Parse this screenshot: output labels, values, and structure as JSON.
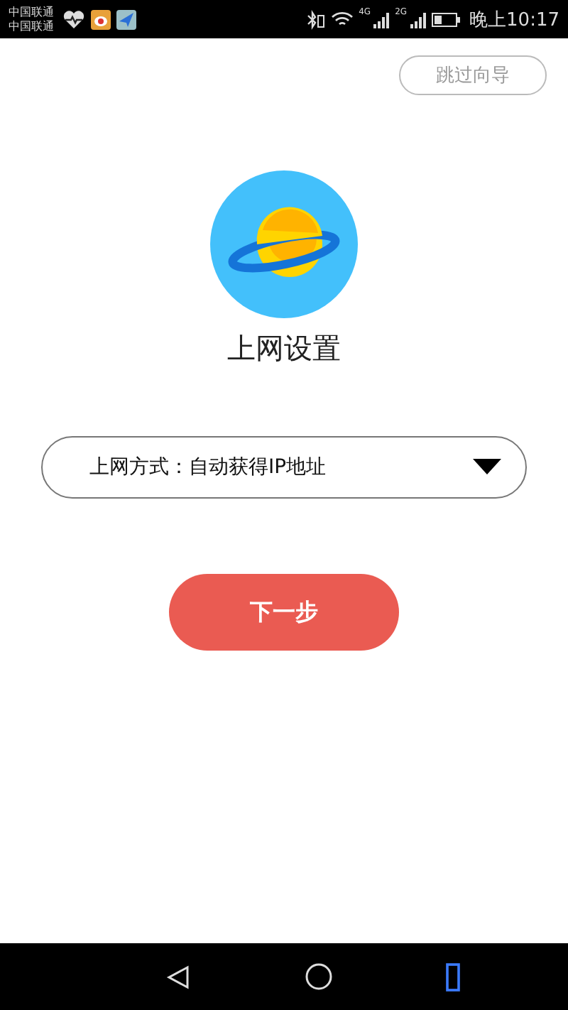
{
  "status_bar": {
    "carriers": [
      "中国联通",
      "中国联通"
    ],
    "network_1": "4G",
    "network_2": "2G",
    "time": "晚上10:17"
  },
  "skip_button": "跳过向导",
  "title": "上网设置",
  "connection_select": {
    "value": "上网方式：自动获得IP地址"
  },
  "next_button": "下一步"
}
